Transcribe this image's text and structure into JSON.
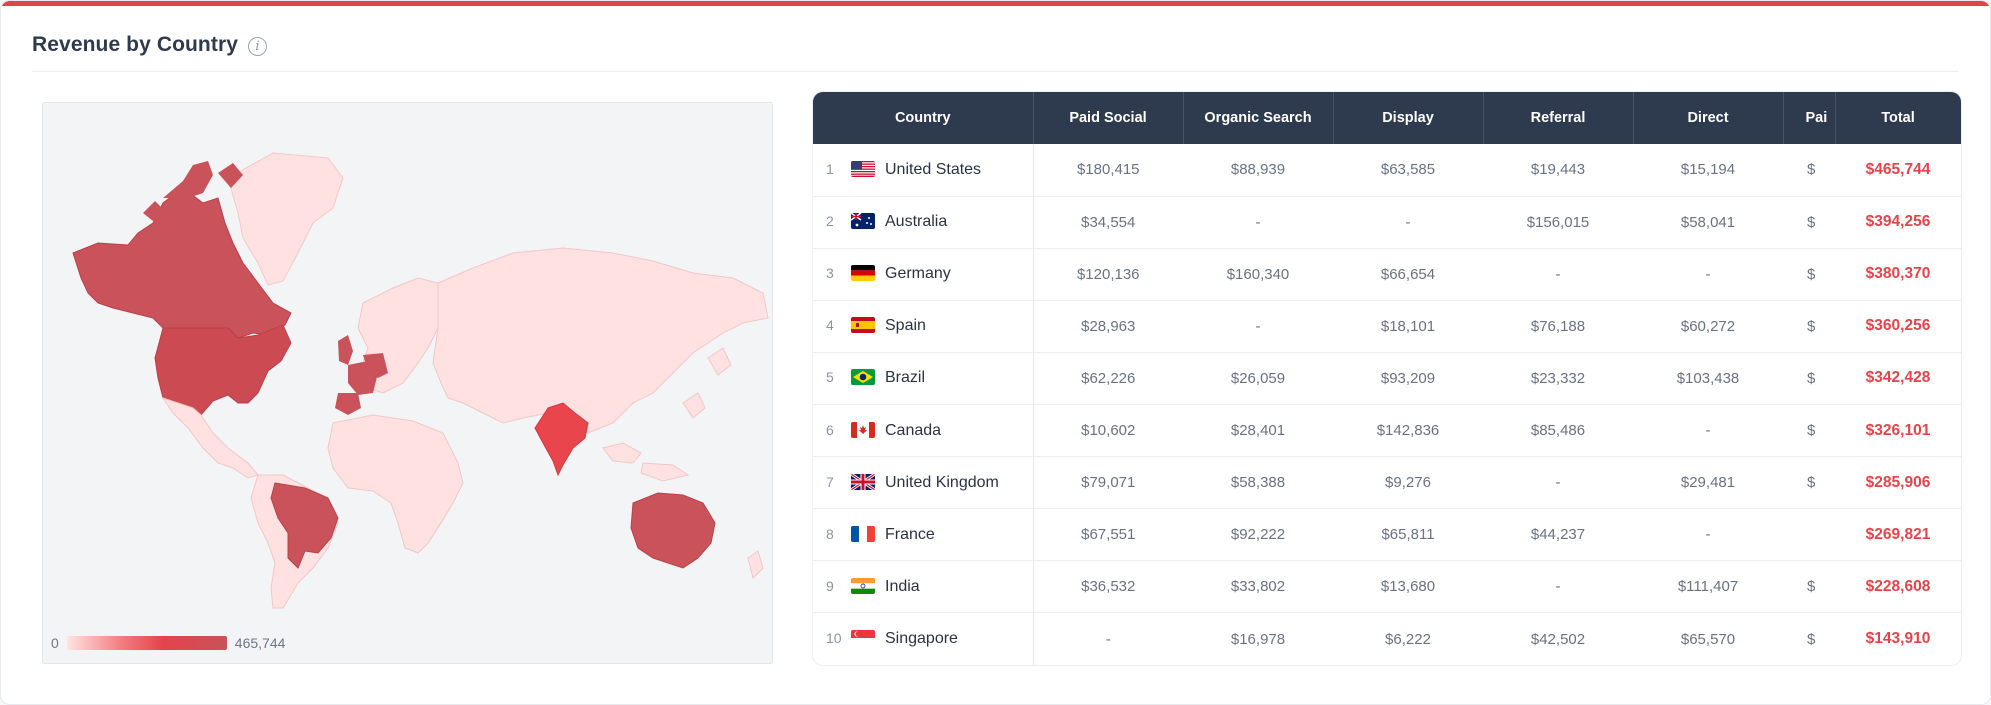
{
  "header": {
    "title": "Revenue by Country",
    "info_icon": "info-icon"
  },
  "legend": {
    "min": "0",
    "max": "465,744"
  },
  "colors": {
    "accent": "#e3444b",
    "header_bg": "#2e3a4d",
    "map_low": "#ffe1e1",
    "map_high": "#c9525b",
    "map_india": "#e8454c"
  },
  "table": {
    "columns": [
      "Country",
      "Paid Social",
      "Organic Search",
      "Display",
      "Referral",
      "Direct",
      "Pai",
      "Total"
    ],
    "rows": [
      {
        "rank": "1",
        "flag": "us",
        "country": "United States",
        "paid_social": "$180,415",
        "organic": "$88,939",
        "display": "$63,585",
        "referral": "$19,443",
        "direct": "$15,194",
        "partial": "$",
        "total": "$465,744"
      },
      {
        "rank": "2",
        "flag": "au",
        "country": "Australia",
        "paid_social": "$34,554",
        "organic": "-",
        "display": "-",
        "referral": "$156,015",
        "direct": "$58,041",
        "partial": "$",
        "total": "$394,256"
      },
      {
        "rank": "3",
        "flag": "de",
        "country": "Germany",
        "paid_social": "$120,136",
        "organic": "$160,340",
        "display": "$66,654",
        "referral": "-",
        "direct": "-",
        "partial": "$",
        "total": "$380,370"
      },
      {
        "rank": "4",
        "flag": "es",
        "country": "Spain",
        "paid_social": "$28,963",
        "organic": "-",
        "display": "$18,101",
        "referral": "$76,188",
        "direct": "$60,272",
        "partial": "$",
        "total": "$360,256"
      },
      {
        "rank": "5",
        "flag": "br",
        "country": "Brazil",
        "paid_social": "$62,226",
        "organic": "$26,059",
        "display": "$93,209",
        "referral": "$23,332",
        "direct": "$103,438",
        "partial": "$",
        "total": "$342,428"
      },
      {
        "rank": "6",
        "flag": "ca",
        "country": "Canada",
        "paid_social": "$10,602",
        "organic": "$28,401",
        "display": "$142,836",
        "referral": "$85,486",
        "direct": "-",
        "partial": "$",
        "total": "$326,101"
      },
      {
        "rank": "7",
        "flag": "gb",
        "country": "United Kingdom",
        "paid_social": "$79,071",
        "organic": "$58,388",
        "display": "$9,276",
        "referral": "-",
        "direct": "$29,481",
        "partial": "$",
        "total": "$285,906"
      },
      {
        "rank": "8",
        "flag": "fr",
        "country": "France",
        "paid_social": "$67,551",
        "organic": "$92,222",
        "display": "$65,811",
        "referral": "$44,237",
        "direct": "-",
        "partial": "",
        "total": "$269,821"
      },
      {
        "rank": "9",
        "flag": "in",
        "country": "India",
        "paid_social": "$36,532",
        "organic": "$33,802",
        "display": "$13,680",
        "referral": "-",
        "direct": "$111,407",
        "partial": "$",
        "total": "$228,608"
      },
      {
        "rank": "10",
        "flag": "sg",
        "country": "Singapore",
        "paid_social": "-",
        "organic": "$16,978",
        "display": "$6,222",
        "referral": "$42,502",
        "direct": "$65,570",
        "partial": "$",
        "total": "$143,910"
      }
    ]
  }
}
